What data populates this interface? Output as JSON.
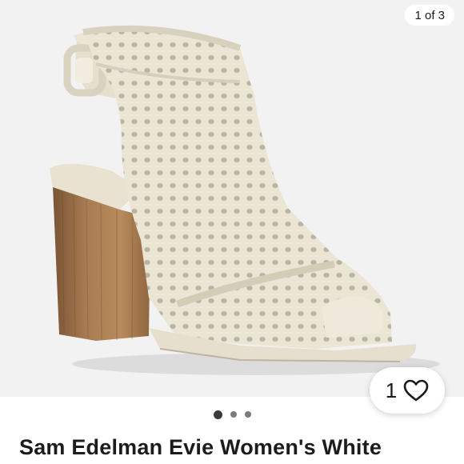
{
  "gallery": {
    "image_subject": "shoe-photo",
    "counter_text": "1 of 3",
    "dots": [
      true,
      false,
      false
    ]
  },
  "like": {
    "count": "1",
    "icon": "heart-icon"
  },
  "listing": {
    "title": "Sam Edelman Evie Women's White"
  },
  "colors": {
    "photo_background": "#f2f2f2",
    "shoe_cream": "#ece6d6",
    "heel_wood": "#9c7149",
    "title_text": "#1c1c1c"
  }
}
